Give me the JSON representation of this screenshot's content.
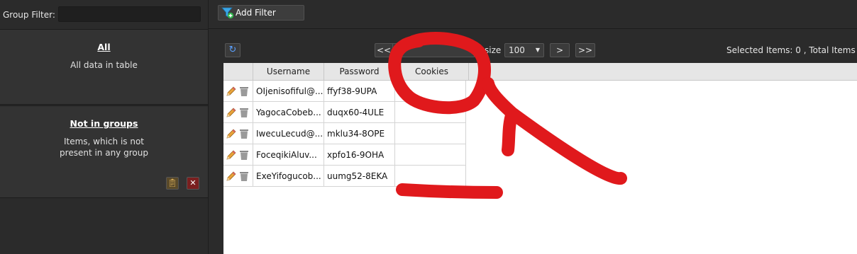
{
  "group_filter": {
    "label": "Group Filter:",
    "value": ""
  },
  "groups": [
    {
      "title": "All",
      "description_lines": [
        "All data in table"
      ]
    },
    {
      "title": "Not in groups",
      "description_lines": [
        "Items, which is not",
        "present in any group"
      ]
    }
  ],
  "toolbar": {
    "add_filter_label": "Add Filter",
    "add_filter_icon": "funnel-plus-icon"
  },
  "pager": {
    "refresh_icon": "refresh-icon",
    "first_label": "<<",
    "page_value": "",
    "size_label": "size",
    "size_value": "100",
    "next_label": ">",
    "last_label": ">>",
    "selected_text": "Selected Items:  0  ,  Total Items"
  },
  "table": {
    "columns": [
      "",
      "Username",
      "Password",
      "Cookies"
    ],
    "rows": [
      {
        "username": "OIjenisofiful@...",
        "password": "ffyf38-9UPA",
        "cookies": ""
      },
      {
        "username": "YagocaCobeb...",
        "password": "duqx60-4ULE",
        "cookies": ""
      },
      {
        "username": "IwecuLecud@...",
        "password": "mklu34-8OPE",
        "cookies": ""
      },
      {
        "username": "FoceqikiAluv...",
        "password": "xpfo16-9OHA",
        "cookies": ""
      },
      {
        "username": "ExeYifogucob...",
        "password": "uumg52-8EKA",
        "cookies": ""
      }
    ]
  },
  "annotation_color": "#e0191c"
}
